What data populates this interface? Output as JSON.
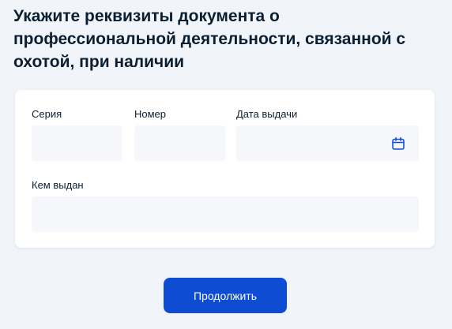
{
  "page": {
    "title": "Укажите реквизиты документа о профессиональной деятельности, связанной с охотой, при наличии"
  },
  "form": {
    "series": {
      "label": "Серия",
      "value": ""
    },
    "number": {
      "label": "Номер",
      "value": ""
    },
    "issue_date": {
      "label": "Дата выдачи",
      "value": "",
      "icon": "calendar-icon"
    },
    "issued_by": {
      "label": "Кем выдан",
      "value": ""
    }
  },
  "actions": {
    "continue_label": "Продолжить"
  },
  "colors": {
    "background": "#f1f4f8",
    "card": "#ffffff",
    "input_background": "#f5f7fa",
    "text": "#0b1f33",
    "primary": "#0d4cd3",
    "icon": "#0d4cd3"
  }
}
